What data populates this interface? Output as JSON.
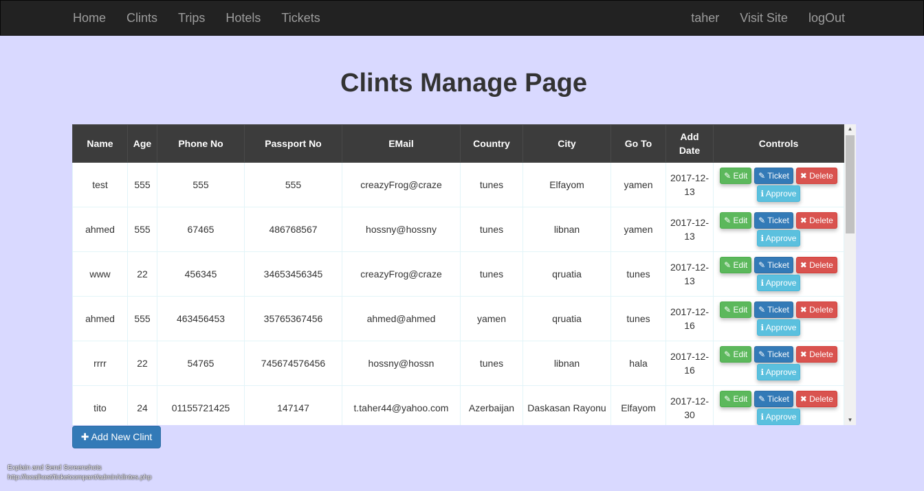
{
  "nav": {
    "left": [
      "Home",
      "Clints",
      "Trips",
      "Hotels",
      "Tickets"
    ],
    "right": [
      "taher",
      "Visit Site",
      "logOut"
    ]
  },
  "page_title": "Clints Manage Page",
  "table": {
    "headers": [
      "Name",
      "Age",
      "Phone No",
      "Passport No",
      "EMail",
      "Country",
      "City",
      "Go To",
      "Add Date",
      "Controls"
    ],
    "rows": [
      [
        "test",
        "555",
        "555",
        "555",
        "creazyFrog@craze",
        "tunes",
        "Elfayom",
        "yamen",
        "2017-12-13"
      ],
      [
        "ahmed",
        "555",
        "67465",
        "486768567",
        "hossny@hossny",
        "tunes",
        "libnan",
        "yamen",
        "2017-12-13"
      ],
      [
        "www",
        "22",
        "456345",
        "34653456345",
        "creazyFrog@craze",
        "tunes",
        "qruatia",
        "tunes",
        "2017-12-13"
      ],
      [
        "ahmed",
        "555",
        "463456453",
        "35765367456",
        "ahmed@ahmed",
        "yamen",
        "qruatia",
        "tunes",
        "2017-12-16"
      ],
      [
        "rrrr",
        "22",
        "54765",
        "745674576456",
        "hossny@hossn",
        "tunes",
        "libnan",
        "hala",
        "2017-12-16"
      ],
      [
        "tito",
        "24",
        "01155721425",
        "147147",
        "t.taher44@yahoo.com",
        "Azerbaijan",
        "Daskasan Rayonu",
        "Elfayom",
        "2017-12-30"
      ]
    ],
    "controls": {
      "edit": "Edit",
      "ticket": "Ticket",
      "delete": "Delete",
      "approve": "Approve"
    }
  },
  "add_button": "Add New Clint",
  "footer": {
    "line1": "Explain and Send Screenshots",
    "line2": "http://localhost/ticketcompant/admin/clintes.php"
  },
  "colors": {
    "background": "#d9d9ff",
    "navbar": "#222222",
    "edit": "#5cb85c",
    "ticket": "#337ab7",
    "delete": "#d9534f",
    "approve": "#5bc0de"
  }
}
